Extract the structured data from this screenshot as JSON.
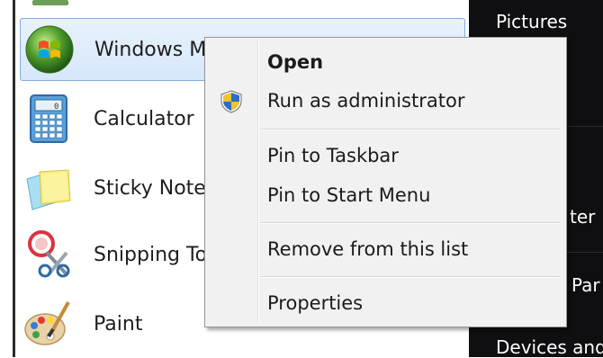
{
  "programs": [
    {
      "label": "Windows M",
      "icon": "windows-media-player-icon"
    },
    {
      "label": "Calculator",
      "icon": "calculator-icon"
    },
    {
      "label": "Sticky Note",
      "icon": "sticky-notes-icon"
    },
    {
      "label": "Snipping To",
      "icon": "snipping-tool-icon"
    },
    {
      "label": "Paint",
      "icon": "paint-icon"
    }
  ],
  "right_panel": {
    "items": [
      "Pictures",
      "ter",
      "Par",
      "Devices and"
    ]
  },
  "context_menu": {
    "items": [
      {
        "label": "Open",
        "bold": true
      },
      {
        "label": "Run as administrator",
        "icon": "uac-shield-icon"
      },
      {
        "label": "Pin to Taskbar"
      },
      {
        "label": "Pin to Start Menu"
      },
      {
        "label": "Remove from this list"
      },
      {
        "label": "Properties"
      }
    ]
  },
  "colors": {
    "selection_border": "#84acdd",
    "menu_background": "#f1f1f1",
    "right_panel_background": "#0f0f12"
  }
}
